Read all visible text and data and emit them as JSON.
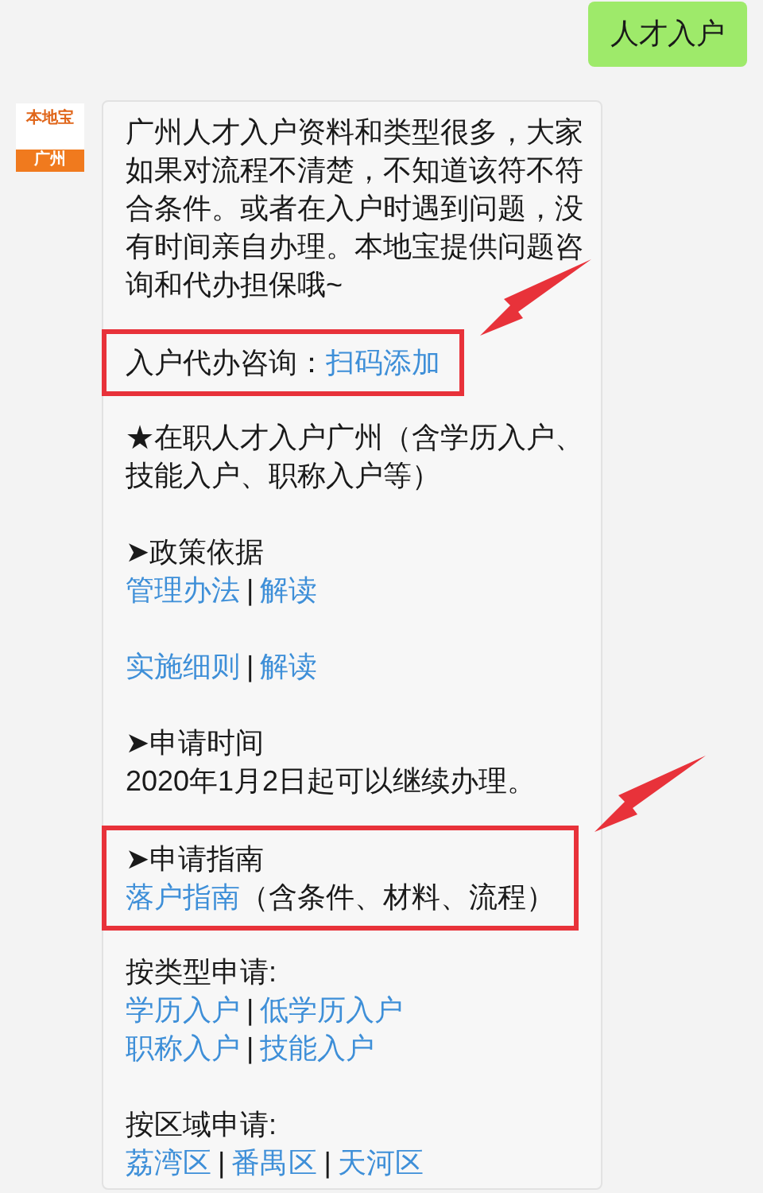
{
  "sent_message": {
    "text": "人才入户"
  },
  "received_message": {
    "avatar": {
      "logo_text": "本地宝",
      "label": "广州"
    },
    "blocks": [
      {
        "highlighted": false,
        "lines": [
          [
            {
              "text": "广州人才入户资料和类型很多，大家如果对流程不清楚，不知道该符不符合条件。或者在入户时遇到问题，没有时间亲自办理。本地宝提供问题咨询和代办担保哦~",
              "link": false
            }
          ]
        ]
      },
      {
        "highlighted": true,
        "lines": [
          [
            {
              "text": "入户代办咨询：",
              "link": false
            },
            {
              "text": "扫码添加",
              "link": true
            }
          ]
        ]
      },
      {
        "highlighted": false,
        "lines": [
          [
            {
              "text": "★在职人才入户广州（含学历入户、技能入户、职称入户等）",
              "link": false
            }
          ]
        ]
      },
      {
        "highlighted": false,
        "lines": [
          [
            {
              "text": "➤政策依据",
              "link": false
            }
          ],
          [
            {
              "text": "管理办法",
              "link": true
            },
            {
              "text": "|",
              "link": false
            },
            {
              "text": "解读",
              "link": true
            }
          ]
        ]
      },
      {
        "highlighted": false,
        "lines": [
          [
            {
              "text": "实施细则",
              "link": true
            },
            {
              "text": "|",
              "link": false
            },
            {
              "text": "解读",
              "link": true
            }
          ]
        ]
      },
      {
        "highlighted": false,
        "lines": [
          [
            {
              "text": "➤申请时间",
              "link": false
            }
          ],
          [
            {
              "text": "2020年1月2日起可以继续办理。",
              "link": false
            }
          ]
        ]
      },
      {
        "highlighted": true,
        "lines": [
          [
            {
              "text": "➤申请指南",
              "link": false
            }
          ],
          [
            {
              "text": "落户指南",
              "link": true
            },
            {
              "text": "（含条件、材料、流程）",
              "link": false
            }
          ]
        ]
      },
      {
        "highlighted": false,
        "lines": [
          [
            {
              "text": "按类型申请:",
              "link": false
            }
          ],
          [
            {
              "text": "学历入户",
              "link": true
            },
            {
              "text": "|",
              "link": false
            },
            {
              "text": "低学历入户",
              "link": true
            }
          ],
          [
            {
              "text": "职称入户",
              "link": true
            },
            {
              "text": "|",
              "link": false
            },
            {
              "text": "技能入户",
              "link": true
            }
          ]
        ]
      },
      {
        "highlighted": false,
        "lines": [
          [
            {
              "text": "按区域申请:",
              "link": false
            }
          ],
          [
            {
              "text": "荔湾区",
              "link": true
            },
            {
              "text": "|",
              "link": false
            },
            {
              "text": "番禺区",
              "link": true
            },
            {
              "text": "|",
              "link": false
            },
            {
              "text": "天河区",
              "link": true
            }
          ]
        ]
      }
    ]
  }
}
